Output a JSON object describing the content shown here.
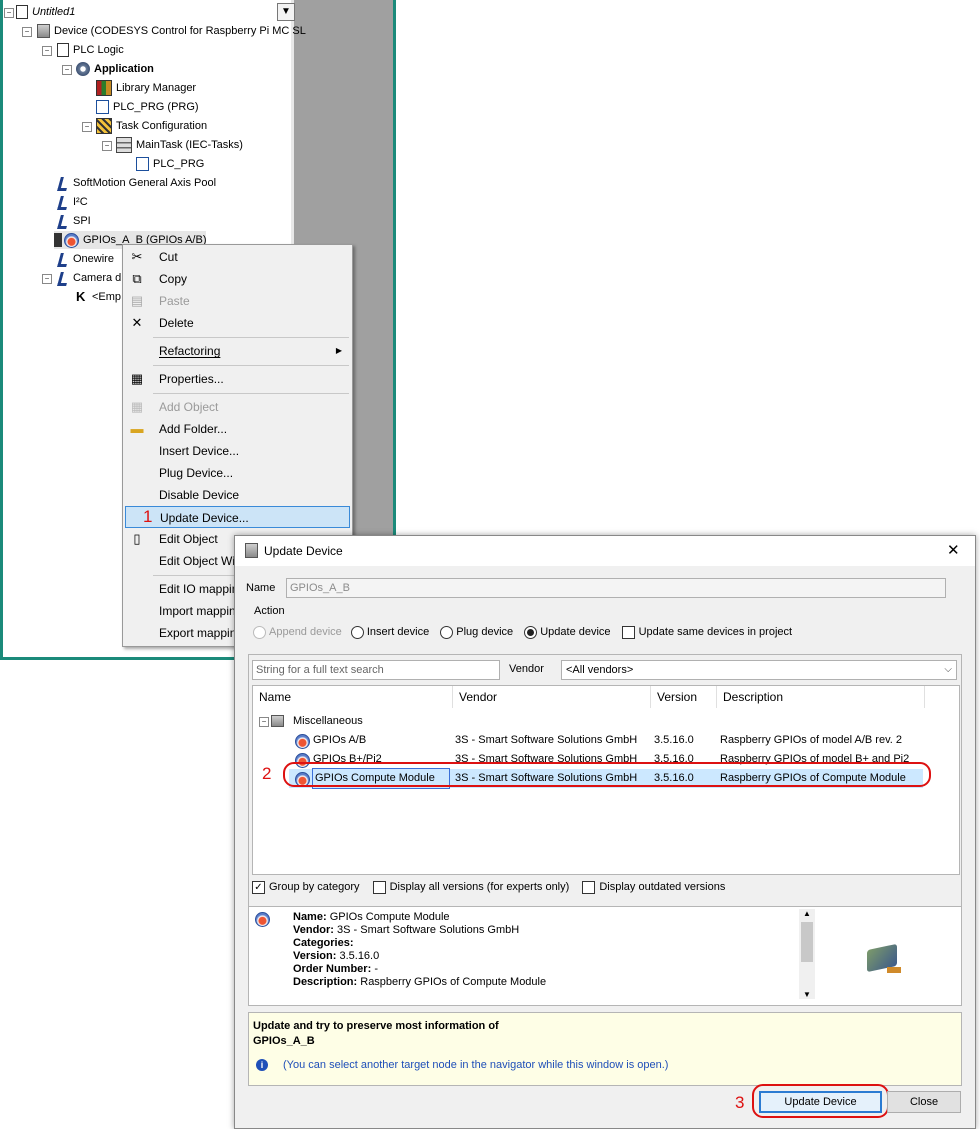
{
  "tree": {
    "collapse_btn": "▼",
    "items": [
      {
        "label": "Untitled1",
        "italic": true,
        "icon": "project-icon"
      },
      {
        "label": "Device (CODESYS Control for Raspberry Pi MC SL",
        "icon": "device-icon"
      },
      {
        "label": "PLC Logic",
        "icon": "plc-logic-icon"
      },
      {
        "label": "Application",
        "bold": true,
        "icon": "application-icon"
      },
      {
        "label": "Library Manager",
        "icon": "library-manager-icon"
      },
      {
        "label": "PLC_PRG (PRG)",
        "icon": "program-icon"
      },
      {
        "label": "Task Configuration",
        "icon": "task-configuration-icon"
      },
      {
        "label": "MainTask (IEC-Tasks)",
        "icon": "task-icon"
      },
      {
        "label": "PLC_PRG",
        "icon": "program-call-icon"
      },
      {
        "label": "SoftMotion General Axis Pool",
        "icon": "axis-pool-icon"
      },
      {
        "label": "I²C",
        "icon": "i2c-icon"
      },
      {
        "label": "SPI",
        "icon": "spi-icon"
      },
      {
        "label": "GPIOs_A_B (GPIOs A/B)",
        "icon": "gpio-icon"
      },
      {
        "label": "Onewire",
        "icon": "onewire-icon"
      },
      {
        "label": "Camera d",
        "icon": "camera-icon"
      },
      {
        "label": "<Emp",
        "icon": "empty-slot-icon"
      }
    ]
  },
  "context_menu": {
    "items": [
      {
        "label": "Cut",
        "icon": "scissors-icon",
        "disabled": false
      },
      {
        "label": "Copy",
        "icon": "copy-icon",
        "disabled": false
      },
      {
        "label": "Paste",
        "icon": "paste-icon",
        "disabled": true
      },
      {
        "label": "Delete",
        "icon": "delete-icon",
        "disabled": false
      },
      {
        "label": "Refactoring",
        "icon": "",
        "disabled": false,
        "submenu": true
      },
      {
        "label": "Properties...",
        "icon": "properties-icon",
        "disabled": false
      },
      {
        "label": "Add Object",
        "icon": "add-object-icon",
        "disabled": true
      },
      {
        "label": "Add Folder...",
        "icon": "folder-icon",
        "disabled": false
      },
      {
        "label": "Insert Device...",
        "icon": "",
        "disabled": false
      },
      {
        "label": "Plug Device...",
        "icon": "",
        "disabled": false
      },
      {
        "label": "Disable Device",
        "icon": "",
        "disabled": false
      },
      {
        "label": "Update Device...",
        "icon": "",
        "disabled": false,
        "highlighted": true
      },
      {
        "label": "Edit Object",
        "icon": "edit-object-icon",
        "disabled": false
      },
      {
        "label": "Edit Object Wi",
        "icon": "",
        "disabled": false
      },
      {
        "label": "Edit IO mappin",
        "icon": "",
        "disabled": false
      },
      {
        "label": "Import mappin",
        "icon": "",
        "disabled": false
      },
      {
        "label": "Export mappin",
        "icon": "",
        "disabled": false
      }
    ],
    "submenu_arrow": "▶"
  },
  "callouts": {
    "one": "1",
    "two": "2",
    "three": "3"
  },
  "dialog": {
    "title": "Update Device",
    "close_glyph": "✕",
    "name_label": "Name",
    "name_value": "GPIOs_A_B",
    "action_label": "Action",
    "actions": {
      "append": "Append device",
      "insert": "Insert device",
      "plug": "Plug device",
      "update": "Update device",
      "update_same": "Update same devices in project"
    },
    "search_placeholder": "String for a full text search",
    "vendor_label": "Vendor",
    "vendor_value": "<All vendors>",
    "columns": {
      "name": "Name",
      "vendor": "Vendor",
      "version": "Version",
      "description": "Description"
    },
    "category": "Miscellaneous",
    "devices": [
      {
        "name": "GPIOs A/B",
        "vendor": "3S - Smart Software Solutions GmbH",
        "version": "3.5.16.0",
        "description": "Raspberry GPIOs of model A/B rev. 2"
      },
      {
        "name": "GPIOs B+/Pi2",
        "vendor": "3S - Smart Software Solutions GmbH",
        "version": "3.5.16.0",
        "description": "Raspberry GPIOs of model B+ and Pi2"
      },
      {
        "name": "GPIOs Compute Module",
        "vendor": "3S - Smart Software Solutions GmbH",
        "version": "3.5.16.0",
        "description": "Raspberry GPIOs of Compute Module",
        "selected": true
      }
    ],
    "options": {
      "group_by_category": "Group by category",
      "display_all_versions": "Display all versions (for experts only)",
      "display_outdated": "Display outdated versions"
    },
    "info": {
      "name_key": "Name:",
      "name_val": "GPIOs Compute Module",
      "vendor_key": "Vendor:",
      "vendor_val": "3S - Smart Software Solutions GmbH",
      "categories_key": "Categories:",
      "categories_val": "",
      "version_key": "Version:",
      "version_val": "3.5.16.0",
      "order_key": "Order Number:",
      "order_val": "-",
      "description_key": "Description:",
      "description_val": "Raspberry GPIOs of Compute Module"
    },
    "hint_line1": "Update and try to preserve most information of",
    "hint_line2": "GPIOs_A_B",
    "hint_note": "(You can select another target node in the navigator while this window is open.)",
    "buttons": {
      "update": "Update Device",
      "close": "Close"
    }
  }
}
